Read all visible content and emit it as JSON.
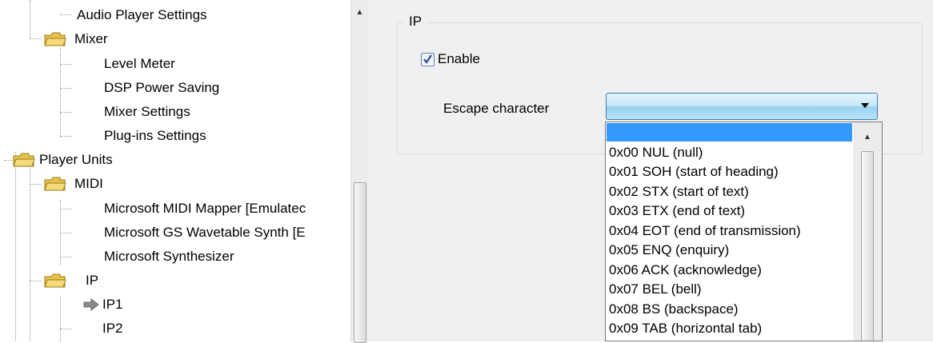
{
  "tree": {
    "items": [
      {
        "label": "Audio Player Settings",
        "icon": "none"
      },
      {
        "label": "Mixer",
        "icon": "folder-icon"
      },
      {
        "label": "Level Meter",
        "icon": "none"
      },
      {
        "label": "DSP Power Saving",
        "icon": "none"
      },
      {
        "label": "Mixer Settings",
        "icon": "none"
      },
      {
        "label": "Plug-ins Settings",
        "icon": "none"
      },
      {
        "label": "Player Units",
        "icon": "folder-icon"
      },
      {
        "label": "MIDI",
        "icon": "folder-icon"
      },
      {
        "label": "Microsoft MIDI Mapper [Emulatec",
        "icon": "none"
      },
      {
        "label": "Microsoft GS Wavetable Synth [E",
        "icon": "none"
      },
      {
        "label": "Microsoft Synthesizer",
        "icon": "none"
      },
      {
        "label": "IP",
        "icon": "folder-icon"
      },
      {
        "label": "IP1",
        "icon": "arrow-icon"
      },
      {
        "label": "IP2",
        "icon": "none"
      }
    ]
  },
  "panel": {
    "group_title": "IP",
    "enable_label": "Enable",
    "enable_checked": true,
    "escape_label": "Escape character",
    "escape_value": ""
  },
  "dropdown": {
    "items": [
      "",
      "0x00 NUL (null)",
      "0x01 SOH (start of heading)",
      "0x02 STX (start of text)",
      "0x03 ETX (end of text)",
      "0x04 EOT (end of transmission)",
      "0x05 ENQ (enquiry)",
      "0x06 ACK (acknowledge)",
      "0x07 BEL (bell)",
      "0x08 BS  (backspace)",
      "0x09 TAB (horizontal tab)"
    ],
    "selected_index": 0
  },
  "colors": {
    "highlight": "#3399ff",
    "folder": "#e8c34a"
  }
}
